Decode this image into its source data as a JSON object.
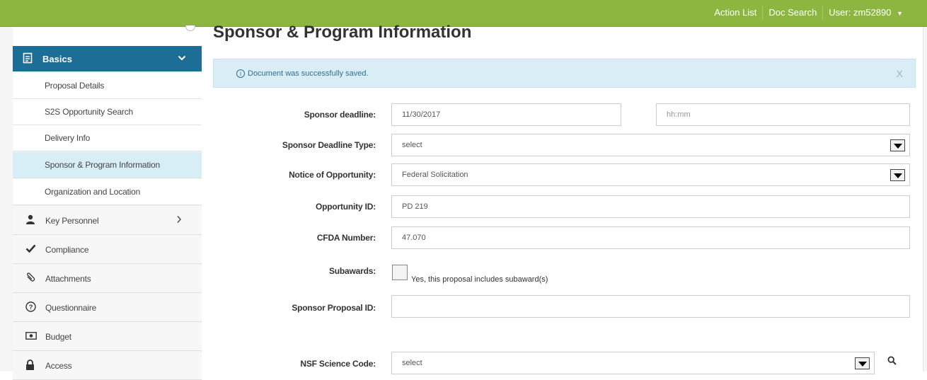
{
  "topbar": {
    "action_list": "Action List",
    "doc_search": "Doc Search",
    "user": "User: zm52890"
  },
  "sidebar": {
    "section": {
      "label": "Basics",
      "icon": "document-icon"
    },
    "subitems": [
      {
        "label": "Proposal Details"
      },
      {
        "label": "S2S Opportunity Search"
      },
      {
        "label": "Delivery Info"
      },
      {
        "label": "Sponsor & Program Information"
      },
      {
        "label": "Organization and Location"
      }
    ],
    "items": [
      {
        "label": "Key Personnel",
        "icon": "user-icon",
        "glyph": "👤"
      },
      {
        "label": "Compliance",
        "icon": "check-icon",
        "glyph": "✔"
      },
      {
        "label": "Attachments",
        "icon": "paperclip-icon",
        "glyph": "📎"
      },
      {
        "label": "Questionnaire",
        "icon": "question-circle-icon",
        "glyph": "?"
      },
      {
        "label": "Budget",
        "icon": "money-icon",
        "glyph": "$"
      },
      {
        "label": "Access",
        "icon": "lock-icon",
        "glyph": "🔒"
      }
    ]
  },
  "main": {
    "title": "Sponsor & Program Information",
    "alert": {
      "message": "Document was successfully saved.",
      "close": "X"
    },
    "form": {
      "sponsor_deadline": {
        "label": "Sponsor deadline:",
        "value": "11/30/2017",
        "time_placeholder": "hh:mm"
      },
      "sponsor_deadline_type": {
        "label": "Sponsor Deadline Type:",
        "value": "select"
      },
      "notice_of_opportunity": {
        "label": "Notice of Opportunity:",
        "value": "Federal Solicitation"
      },
      "opportunity_id": {
        "label": "Opportunity ID:",
        "value": "PD 219"
      },
      "cfda_number": {
        "label": "CFDA Number:",
        "value": "47.070"
      },
      "subawards": {
        "label": "Subawards:",
        "checkbox_label": "Yes, this proposal includes subaward(s)",
        "checked": false
      },
      "sponsor_proposal_id": {
        "label": "Sponsor Proposal ID:",
        "value": ""
      },
      "nsf_science_code": {
        "label": "NSF Science Code:",
        "value": "select"
      }
    }
  }
}
